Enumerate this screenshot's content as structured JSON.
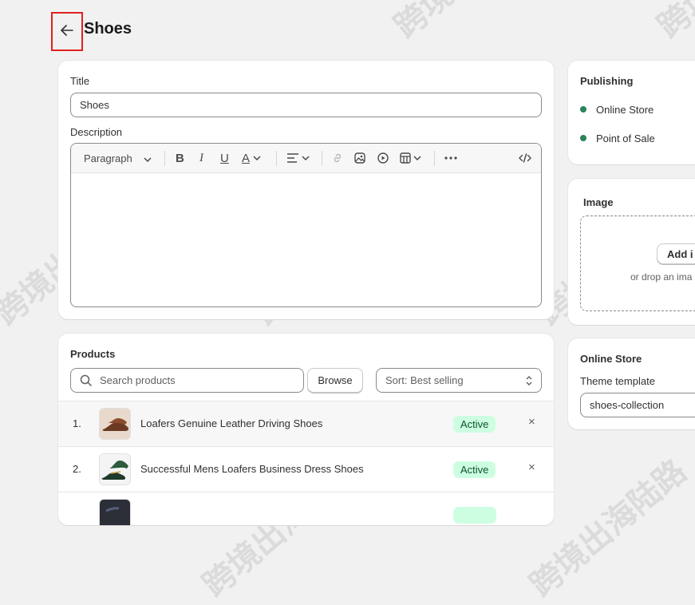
{
  "header": {
    "back_icon": "arrow-left-icon",
    "title": "Shoes"
  },
  "details": {
    "title_label": "Title",
    "title_value": "Shoes",
    "description_label": "Description",
    "toolbar": {
      "paragraph": "Paragraph"
    }
  },
  "products": {
    "heading": "Products",
    "search_placeholder": "Search products",
    "browse_label": "Browse",
    "sort_label": "Sort: Best selling",
    "items": [
      {
        "num": "1.",
        "name": "Loafers Genuine Leather Driving Shoes",
        "status": "Active",
        "remove": "×"
      },
      {
        "num": "2.",
        "name": "Successful Mens Loafers Business Dress Shoes",
        "status": "Active",
        "remove": "×"
      },
      {
        "num": "",
        "name": "",
        "status": "",
        "remove": ""
      }
    ]
  },
  "publishing": {
    "heading": "Publishing",
    "channels": [
      {
        "label": "Online Store",
        "color": "#29845a"
      },
      {
        "label": "Point of Sale",
        "color": "#29845a"
      }
    ]
  },
  "image": {
    "heading": "Image",
    "add_label": "Add i",
    "drop_text": "or drop an ima"
  },
  "online_store": {
    "heading": "Online Store",
    "theme_label": "Theme template",
    "theme_value": "shoes-collection"
  },
  "watermark": "跨境出海陆路"
}
